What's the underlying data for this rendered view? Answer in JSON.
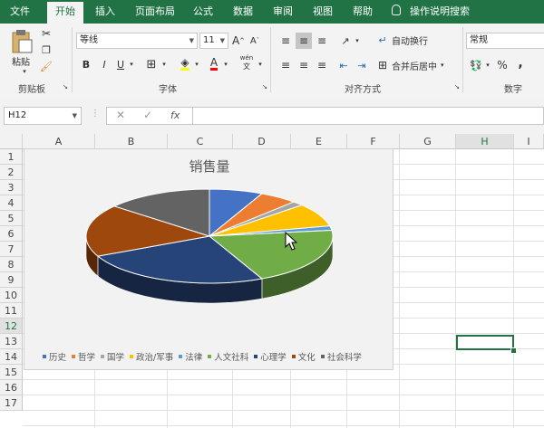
{
  "tabs": [
    "文件",
    "开始",
    "插入",
    "页面布局",
    "公式",
    "数据",
    "审阅",
    "视图",
    "帮助"
  ],
  "tell_me": "操作说明搜索",
  "ribbon": {
    "clipboard": {
      "label": "剪贴板",
      "paste": "粘贴"
    },
    "font": {
      "label": "字体",
      "name": "等线",
      "size": "11",
      "bold": "B",
      "italic": "I",
      "underline": "U",
      "grow": "A",
      "shrink": "A",
      "color_a": "A",
      "wen": "wén"
    },
    "alignment": {
      "label": "对齐方式",
      "wrap": "自动换行",
      "merge": "合并后居中"
    },
    "number": {
      "label": "数字",
      "format": "常规",
      "percent": "%",
      "comma": ","
    }
  },
  "formula_bar": {
    "name_box": "H12",
    "fx": "fx",
    "formula": ""
  },
  "columns": [
    "A",
    "B",
    "C",
    "D",
    "E",
    "F",
    "G",
    "H",
    "I"
  ],
  "rows": [
    "1",
    "2",
    "3",
    "4",
    "5",
    "6",
    "7",
    "8",
    "9",
    "10",
    "11",
    "12",
    "13",
    "14",
    "15",
    "16",
    "17"
  ],
  "selected_cell": {
    "column": "H",
    "row": "12"
  },
  "colors": {
    "excel_green": "#217346"
  },
  "chart_data": {
    "type": "pie",
    "title": "销售量",
    "style": "3d",
    "legend_position": "bottom",
    "categories": [
      "历史",
      "哲学",
      "国学",
      "政治/军事",
      "法律",
      "人文社科",
      "心理学",
      "文化",
      "社会科学"
    ],
    "values": [
      7,
      5,
      1.5,
      8,
      1.5,
      20,
      25,
      18,
      14
    ],
    "colors": [
      "#4472c4",
      "#ed7d31",
      "#a5a5a5",
      "#ffc000",
      "#5b9bd5",
      "#70ad47",
      "#264478",
      "#9e480e",
      "#636363"
    ]
  }
}
